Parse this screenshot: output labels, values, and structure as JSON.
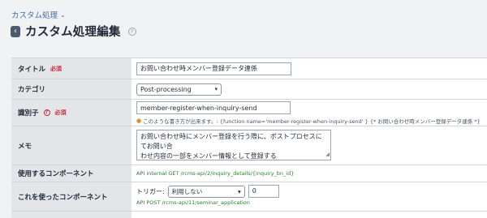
{
  "breadcrumb": {
    "label": "カスタム処理"
  },
  "header": {
    "title": "カスタム処理編集"
  },
  "form": {
    "title_row": {
      "label": "タイトル",
      "required": "必須",
      "value": "お問い合わせ時メンバー登録データ連係"
    },
    "category_row": {
      "label": "カテゴリ",
      "value": "Post-processing"
    },
    "identifier_row": {
      "label": "識別子",
      "required": "必須",
      "value": "member-register-when-inquiry-send",
      "hint": "このような書き方が出来ます。: {function name='member-register-when-inquiry-send' } {* お問い合わせ時メンバー登録データ連係 *}"
    },
    "memo_row": {
      "label": "メモ",
      "line1": "お問い合わせ時にメンバー登録を行う際に、ポストプロセスにてお問い合",
      "line2": "わせ内容の一部をメンバー情報として登録する"
    },
    "used_components_row": {
      "label": "使用するコンポーネント",
      "link": "API internal GET /rcms-api/2/inquiry_details/{inquiry_bn_id}"
    },
    "using_components_row": {
      "label": "これを使ったコンポーネント",
      "trigger_label": "トリガー:",
      "trigger_value": "利用しない",
      "number_value": "0",
      "link": "API POST /rcms-api/11/seminar_application"
    }
  }
}
